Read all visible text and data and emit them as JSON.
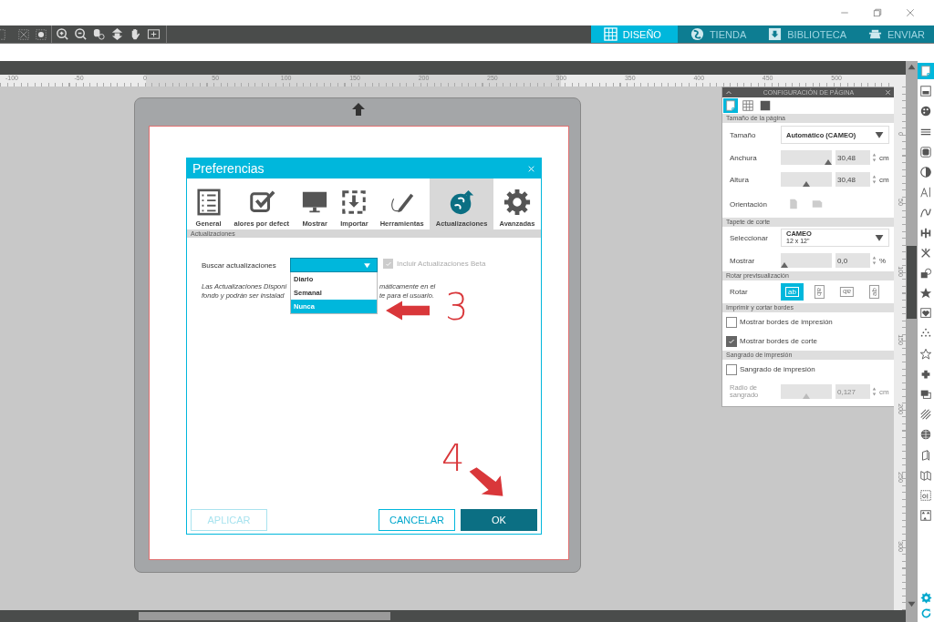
{
  "nav_tabs": [
    {
      "label": "DISEÑO",
      "kind": "grid",
      "selected": true
    },
    {
      "label": "TIENDA",
      "kind": "globe",
      "selected": false
    },
    {
      "label": "BIBLIOTECA",
      "kind": "download",
      "selected": false
    },
    {
      "label": "ENVIAR",
      "kind": "cutter",
      "selected": false
    }
  ],
  "ruler": {
    "labels": [
      "-100",
      "-50",
      "0",
      "50",
      "100",
      "150",
      "200",
      "250",
      "300",
      "350",
      "400",
      "450",
      "500"
    ]
  },
  "vertical_ruler": {
    "labels": [
      "0",
      "50",
      "100",
      "150",
      "200",
      "250",
      "300"
    ]
  },
  "dialog": {
    "title": "Preferencias",
    "tabs": [
      {
        "label": "General",
        "kind": "list",
        "selected": false
      },
      {
        "label": "alores por defect",
        "kind": "check",
        "selected": false
      },
      {
        "label": "Mostrar",
        "kind": "monitor",
        "selected": false
      },
      {
        "label": "Importar",
        "kind": "import",
        "selected": false
      },
      {
        "label": "Herramientas",
        "kind": "pencil",
        "selected": false
      },
      {
        "label": "Actualizaciones",
        "kind": "update",
        "selected": true
      },
      {
        "label": "Avanzadas",
        "kind": "gear",
        "selected": false
      }
    ],
    "section": "Actualizaciones",
    "field_label": "Buscar actualizaciones",
    "dropdown": {
      "expanded": true,
      "options": [
        {
          "label": "Diario",
          "selected": false
        },
        {
          "label": "Semanal",
          "selected": false
        },
        {
          "label": "Nunca",
          "selected": true
        }
      ]
    },
    "beta": {
      "label": "Incluir Actualizaciones Beta",
      "checked": true,
      "disabled": true
    },
    "description_left": [
      "Las Actualizaciones Disponi",
      "fondo y podrán ser instalad"
    ],
    "description_right": [
      "máticamente en el",
      "te para el usuario."
    ],
    "buttons": [
      {
        "label": "APLICAR",
        "kind": "outline",
        "disabled": true
      },
      {
        "label": "CANCELAR",
        "kind": "outline",
        "disabled": false
      },
      {
        "label": "OK",
        "kind": "primary",
        "disabled": false
      }
    ]
  },
  "annotations": [
    {
      "label": "3",
      "kind": "left"
    },
    {
      "label": "4",
      "kind": "down-right"
    }
  ],
  "page_panel": {
    "title": "CONFIGURACIÓN DE PÁGINA",
    "view_tabs": [
      {
        "kind": "page",
        "selected": true
      },
      {
        "kind": "grid",
        "selected": false
      },
      {
        "kind": "square",
        "selected": false
      }
    ],
    "sections": [
      {
        "title": "Tamaño de la página",
        "rows": [
          {
            "kind": "select",
            "label": "Tamaño",
            "value": "Automático (CAMEO)"
          },
          {
            "kind": "slider",
            "label": "Anchura",
            "level": 1.0,
            "value": "30,48",
            "unit": "cm",
            "disabled": false
          },
          {
            "kind": "slider",
            "label": "Altura",
            "level": 0.5,
            "value": "30,48",
            "unit": "cm",
            "disabled": false
          },
          {
            "kind": "orientation",
            "label": "Orientación"
          }
        ]
      },
      {
        "title": "Tapete de corte",
        "rows": [
          {
            "kind": "select",
            "label": "Seleccionar",
            "value": "CAMEO",
            "sub": "12 x 12\""
          },
          {
            "kind": "slider",
            "label": "Mostrar",
            "level": 0.0,
            "value": "0,0",
            "unit": "%",
            "disabled": false
          }
        ]
      },
      {
        "title": "Rotar previsualización",
        "rows": [
          {
            "kind": "rotate",
            "label": "Rotar",
            "options": [
              {
                "label": "ab",
                "kind": "r0",
                "selected": true
              },
              {
                "label": "ab",
                "kind": "r90",
                "selected": false
              },
              {
                "label": "ab",
                "kind": "r180",
                "selected": false
              },
              {
                "label": "ab",
                "kind": "r270",
                "selected": false
              }
            ]
          }
        ]
      },
      {
        "title": "Imprimir y cortar bordes",
        "rows": [
          {
            "kind": "checkbox",
            "label": "Mostrar bordes de impresión",
            "checked": false
          },
          {
            "kind": "checkbox",
            "label": "Mostrar bordes de corte",
            "checked": true
          }
        ]
      },
      {
        "title": "Sangrado de impresión",
        "rows": [
          {
            "kind": "checkbox",
            "label": "Sangrado de impresión",
            "checked": false
          },
          {
            "kind": "slider",
            "label": "Radio de sangrado",
            "level": 0.5,
            "value": "0,127",
            "unit": "cm",
            "disabled": true
          }
        ]
      }
    ]
  },
  "tool_strip": [
    {
      "kind": "page",
      "selected": true
    },
    {
      "kind": "image",
      "selected": false
    },
    {
      "kind": "palette",
      "selected": false
    },
    {
      "kind": "lines",
      "selected": false
    },
    {
      "kind": "frame",
      "selected": false
    },
    {
      "kind": "contrast",
      "selected": false
    },
    {
      "kind": "textcursor",
      "selected": false
    },
    {
      "kind": "curve",
      "selected": false
    },
    {
      "kind": "align",
      "selected": false
    },
    {
      "kind": "sparkle",
      "selected": false
    },
    {
      "kind": "shapes",
      "selected": false
    },
    {
      "kind": "starbadge",
      "selected": false
    },
    {
      "kind": "heart",
      "selected": false
    },
    {
      "kind": "dots",
      "selected": false
    },
    {
      "kind": "star",
      "selected": false
    },
    {
      "kind": "puzzle",
      "selected": false
    },
    {
      "kind": "layers",
      "selected": false
    },
    {
      "kind": "hatch",
      "selected": false
    },
    {
      "kind": "globe",
      "selected": false
    },
    {
      "kind": "cube",
      "selected": false
    },
    {
      "kind": "map",
      "selected": false
    },
    {
      "kind": "dotbox",
      "selected": false
    },
    {
      "kind": "pattern",
      "selected": false
    }
  ]
}
